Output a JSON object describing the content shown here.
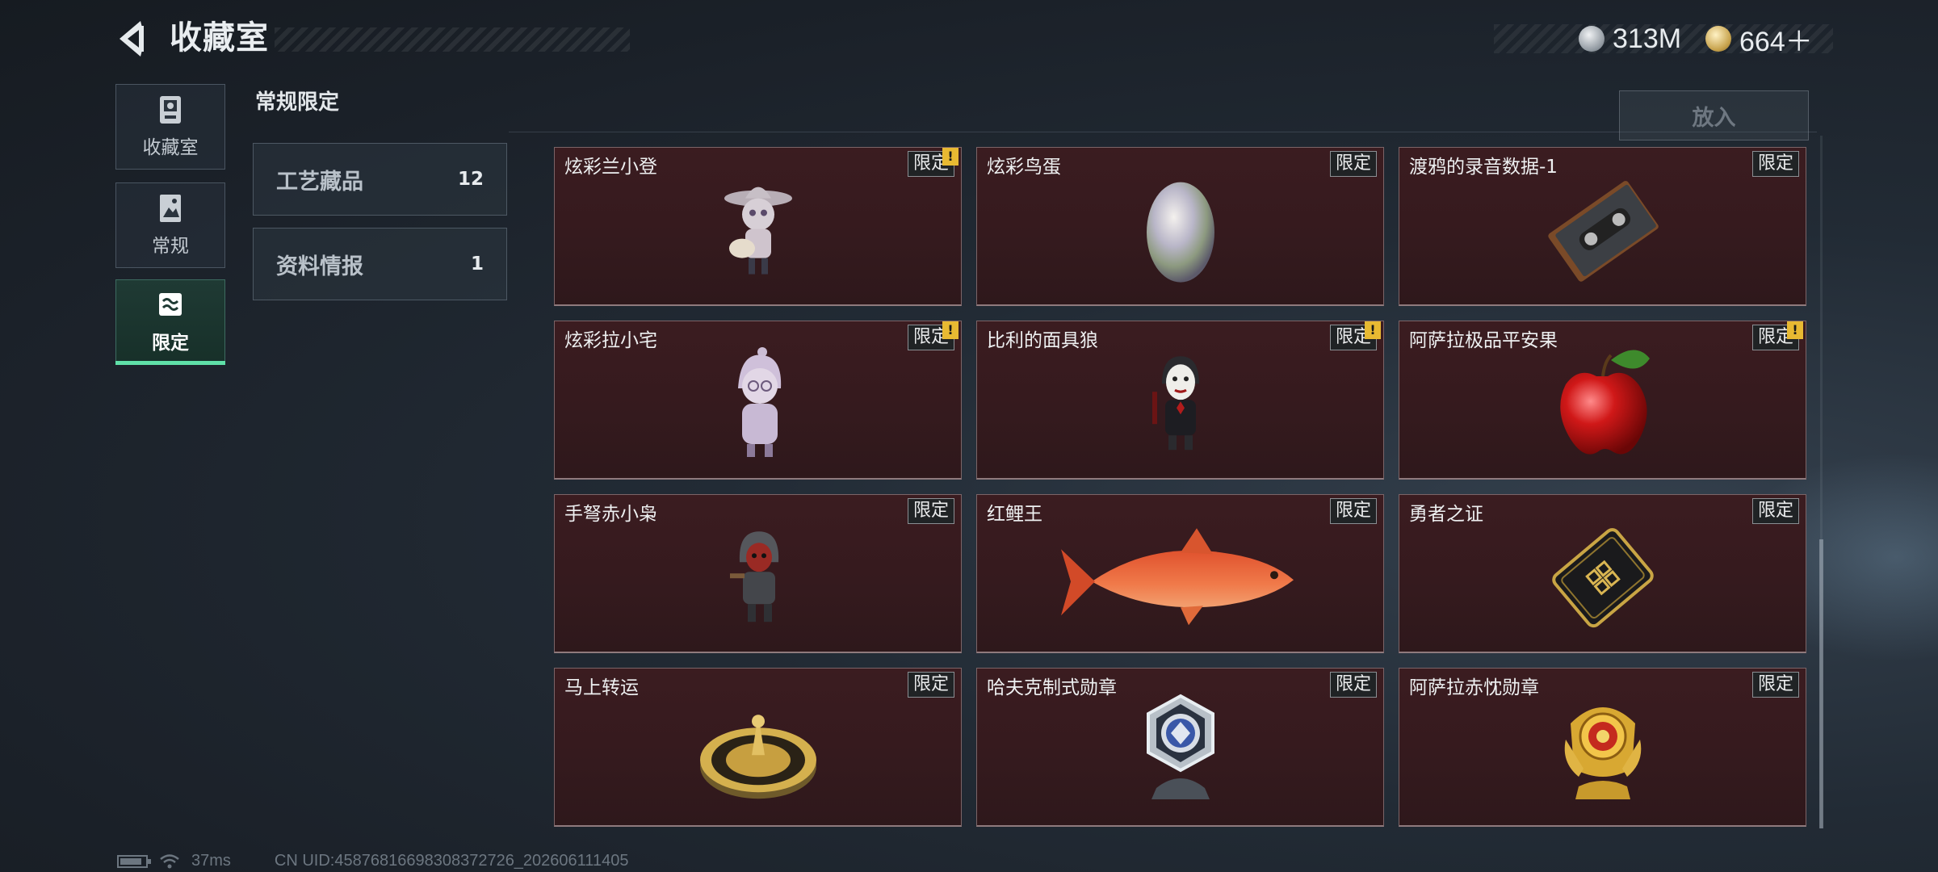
{
  "header": {
    "title": "收藏室",
    "currencies": [
      {
        "icon": "silver-coin-icon",
        "value": "313M"
      },
      {
        "icon": "gold-coin-icon",
        "value": "664＋"
      }
    ]
  },
  "sidebar": {
    "tabs": [
      {
        "label": "收藏室",
        "icon": "trophy-icon",
        "active": false
      },
      {
        "label": "常规",
        "icon": "picture-icon",
        "active": false
      },
      {
        "label": "限定",
        "icon": "limited-icon",
        "active": true
      }
    ]
  },
  "categories": {
    "section_title": "常规限定",
    "items": [
      {
        "name": "工艺藏品",
        "count": "12"
      },
      {
        "name": "资料情报",
        "count": "1"
      }
    ]
  },
  "actions": {
    "put_in": "放入"
  },
  "items": [
    {
      "name": "炫彩兰小登",
      "badge": "限定",
      "alert": true,
      "icon": "figure-sombrero-icon"
    },
    {
      "name": "炫彩鸟蛋",
      "badge": "限定",
      "alert": false,
      "icon": "pearl-egg-icon"
    },
    {
      "name": "渡鸦的录音数据-1",
      "badge": "限定",
      "alert": false,
      "icon": "cassette-tape-icon"
    },
    {
      "name": "炫彩拉小宅",
      "badge": "限定",
      "alert": true,
      "icon": "figure-hoodie-icon"
    },
    {
      "name": "比利的面具狼",
      "badge": "限定",
      "alert": true,
      "icon": "puppet-figure-icon"
    },
    {
      "name": "阿萨拉极品平安果",
      "badge": "限定",
      "alert": true,
      "icon": "red-apple-icon"
    },
    {
      "name": "手弩赤小枭",
      "badge": "限定",
      "alert": false,
      "icon": "hooded-figure-icon"
    },
    {
      "name": "红鲤王",
      "badge": "限定",
      "alert": false,
      "icon": "red-carp-icon"
    },
    {
      "name": "勇者之证",
      "badge": "限定",
      "alert": false,
      "icon": "black-card-icon"
    },
    {
      "name": "马上转运",
      "badge": "限定",
      "alert": false,
      "icon": "gold-wheel-icon"
    },
    {
      "name": "哈夫克制式勋章",
      "badge": "限定",
      "alert": false,
      "icon": "silver-medal-icon"
    },
    {
      "name": "阿萨拉赤忱勋章",
      "badge": "限定",
      "alert": false,
      "icon": "gold-medal-icon"
    }
  ],
  "alert_symbol": "!",
  "status": {
    "ping": "37ms",
    "uid": "CN UID:4587681669830837​2726_202606111405",
    "battery_level": 0.85
  },
  "scroll": {
    "position_fraction": 0.55
  }
}
